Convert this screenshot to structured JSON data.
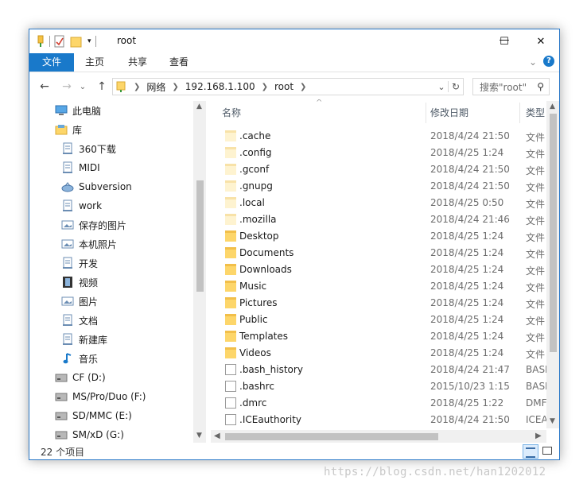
{
  "window": {
    "title": "root"
  },
  "title_buttons": {
    "minimize": "—",
    "maximize": "☐",
    "close": "✕"
  },
  "ribbon": {
    "tabs": [
      "文件",
      "主页",
      "共享",
      "查看"
    ],
    "expand": "⌄",
    "help": "?"
  },
  "nav": {
    "back": "←",
    "forward": "→",
    "recent": "⌄",
    "up": "↑",
    "breadcrumb": [
      "网络",
      "192.168.1.100",
      "root"
    ],
    "address_dropdown": "⌄",
    "refresh": "↻",
    "search_placeholder": "搜索\"root\"",
    "search_icon": "⚲"
  },
  "sidebar": {
    "items": [
      {
        "label": "此电脑",
        "icon": "computer-icon",
        "level": 0
      },
      {
        "label": "库",
        "icon": "library-icon",
        "level": 0
      },
      {
        "label": "360下载",
        "icon": "library-doc-icon",
        "level": 1
      },
      {
        "label": "MIDI",
        "icon": "library-doc-icon",
        "level": 1
      },
      {
        "label": "Subversion",
        "icon": "subversion-icon",
        "level": 1
      },
      {
        "label": "work",
        "icon": "library-doc-icon",
        "level": 1
      },
      {
        "label": "保存的图片",
        "icon": "picture-library-icon",
        "level": 1
      },
      {
        "label": "本机照片",
        "icon": "picture-library-icon",
        "level": 1
      },
      {
        "label": "开发",
        "icon": "library-doc-icon",
        "level": 1
      },
      {
        "label": "视频",
        "icon": "video-library-icon",
        "level": 1
      },
      {
        "label": "图片",
        "icon": "picture-library-icon",
        "level": 1
      },
      {
        "label": "文档",
        "icon": "library-doc-icon",
        "level": 1
      },
      {
        "label": "新建库",
        "icon": "library-doc-icon",
        "level": 1
      },
      {
        "label": "音乐",
        "icon": "music-library-icon",
        "level": 1
      },
      {
        "label": "CF (D:)",
        "icon": "drive-icon",
        "level": 0
      },
      {
        "label": "MS/Pro/Duo (F:)",
        "icon": "drive-icon",
        "level": 0
      },
      {
        "label": "SD/MMC (E:)",
        "icon": "drive-icon",
        "level": 0
      },
      {
        "label": "SM/xD (G:)",
        "icon": "drive-icon",
        "level": 0
      }
    ]
  },
  "columns": {
    "name": "名称",
    "date": "修改日期",
    "type": "类型",
    "sort_indicator": "^"
  },
  "files": [
    {
      "name": ".cache",
      "date": "2018/4/24 21:50",
      "type": "文件",
      "kind": "folder-hidden"
    },
    {
      "name": ".config",
      "date": "2018/4/25 1:24",
      "type": "文件",
      "kind": "folder-hidden"
    },
    {
      "name": ".gconf",
      "date": "2018/4/24 21:50",
      "type": "文件",
      "kind": "folder-hidden"
    },
    {
      "name": ".gnupg",
      "date": "2018/4/24 21:50",
      "type": "文件",
      "kind": "folder-hidden"
    },
    {
      "name": ".local",
      "date": "2018/4/25 0:50",
      "type": "文件",
      "kind": "folder-hidden"
    },
    {
      "name": ".mozilla",
      "date": "2018/4/24 21:46",
      "type": "文件",
      "kind": "folder-hidden"
    },
    {
      "name": "Desktop",
      "date": "2018/4/25 1:24",
      "type": "文件",
      "kind": "folder"
    },
    {
      "name": "Documents",
      "date": "2018/4/25 1:24",
      "type": "文件",
      "kind": "folder"
    },
    {
      "name": "Downloads",
      "date": "2018/4/25 1:24",
      "type": "文件",
      "kind": "folder"
    },
    {
      "name": "Music",
      "date": "2018/4/25 1:24",
      "type": "文件",
      "kind": "folder"
    },
    {
      "name": "Pictures",
      "date": "2018/4/25 1:24",
      "type": "文件",
      "kind": "folder"
    },
    {
      "name": "Public",
      "date": "2018/4/25 1:24",
      "type": "文件",
      "kind": "folder"
    },
    {
      "name": "Templates",
      "date": "2018/4/25 1:24",
      "type": "文件",
      "kind": "folder"
    },
    {
      "name": "Videos",
      "date": "2018/4/25 1:24",
      "type": "文件",
      "kind": "folder"
    },
    {
      "name": ".bash_history",
      "date": "2018/4/24 21:47",
      "type": "BASI",
      "kind": "doc"
    },
    {
      "name": ".bashrc",
      "date": "2015/10/23 1:15",
      "type": "BASI",
      "kind": "doc"
    },
    {
      "name": ".dmrc",
      "date": "2018/4/25 1:22",
      "type": "DMF",
      "kind": "doc"
    },
    {
      "name": ".ICEauthority",
      "date": "2018/4/24 21:50",
      "type": "ICEA",
      "kind": "doc"
    }
  ],
  "status": {
    "item_count": "22 个项目"
  },
  "watermark": "https://blog.csdn.net/han1202012",
  "colors": {
    "accent": "#1979ca",
    "folder": "#fdd66a"
  }
}
